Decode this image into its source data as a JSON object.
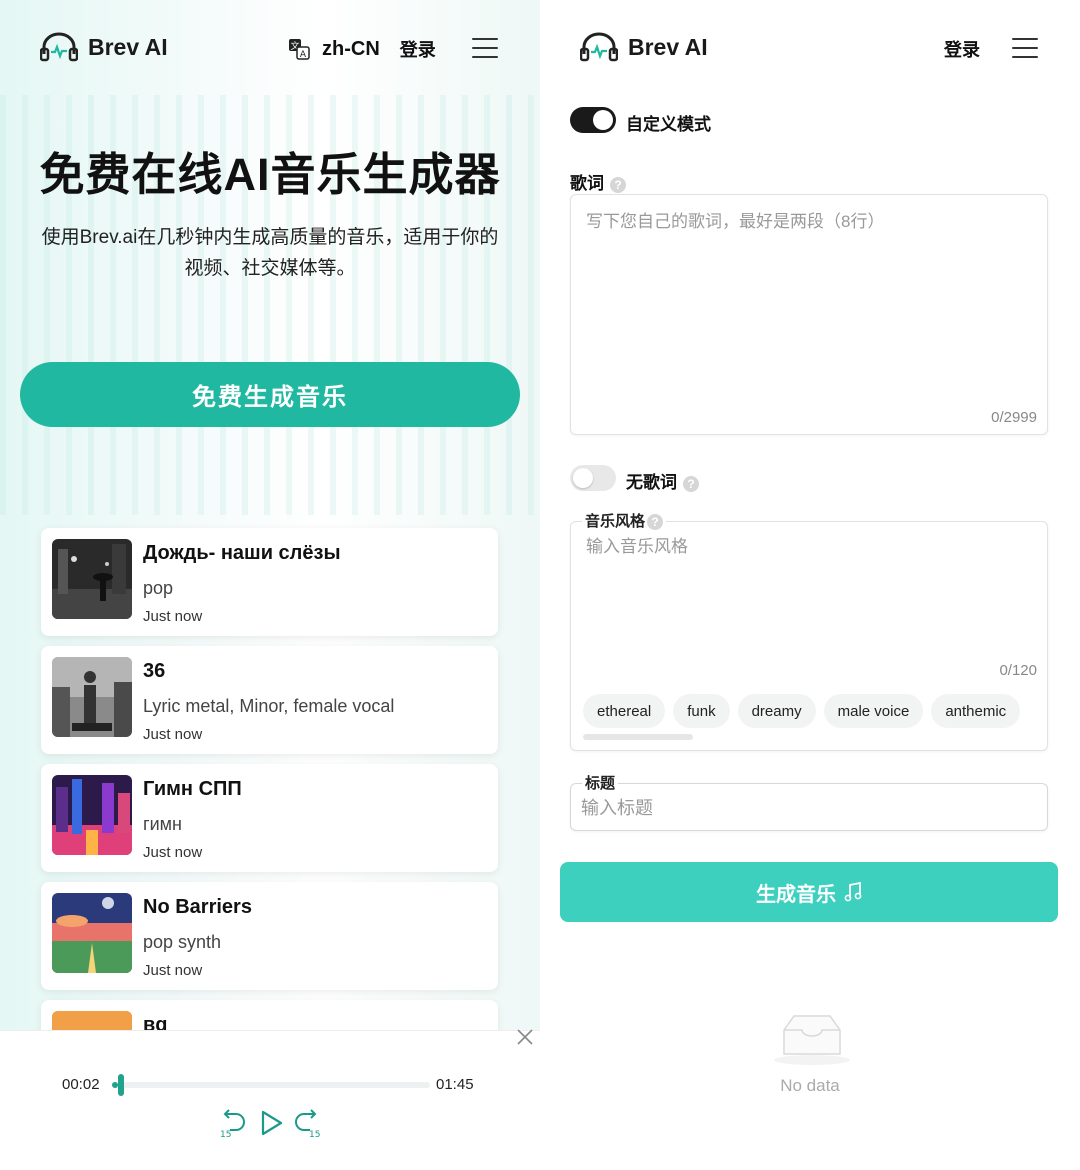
{
  "left": {
    "header": {
      "brand": "Brev AI",
      "language": "zh-CN",
      "login": "登录"
    },
    "hero": {
      "title": "免费在线AI音乐生成器",
      "subtitle_line1": "使用Brev.ai在几秒钟内生成高质量的音乐，适用于你的",
      "subtitle_line2": "视频、社交媒体等。",
      "cta": "免费生成音乐"
    },
    "songs": [
      {
        "title": "Дождь- наши слёзы",
        "style": "pop",
        "time": "Just now"
      },
      {
        "title": "36",
        "style": "Lyric metal, Minor, female vocal",
        "time": "Just now"
      },
      {
        "title": "Гимн СПП",
        "style": "гимн",
        "time": "Just now"
      },
      {
        "title": "No Barriers",
        "style": "pop synth",
        "time": "Just now"
      },
      {
        "title": "вq",
        "style": "",
        "time": ""
      }
    ],
    "player": {
      "current": "00:02",
      "total": "01:45",
      "progress": 0.02
    }
  },
  "right": {
    "header": {
      "brand": "Brev AI",
      "login": "登录"
    },
    "custom_mode": {
      "label": "自定义模式",
      "on": true
    },
    "lyrics": {
      "label": "歌词",
      "placeholder": "写下您自己的歌词，最好是两段（8行）",
      "counter": "0/2999"
    },
    "instrumental": {
      "label": "无歌词",
      "on": false
    },
    "style": {
      "label": "音乐风格",
      "placeholder": "输入音乐风格",
      "counter": "0/120",
      "tags": [
        "ethereal",
        "funk",
        "dreamy",
        "male voice",
        "anthemic"
      ]
    },
    "title_field": {
      "label": "标题",
      "placeholder": "输入标题"
    },
    "generate": "生成音乐",
    "empty": "No data"
  },
  "colors": {
    "accent": "#20b8a0",
    "accent_light": "#3dd0be",
    "progress": "#20a28c"
  }
}
